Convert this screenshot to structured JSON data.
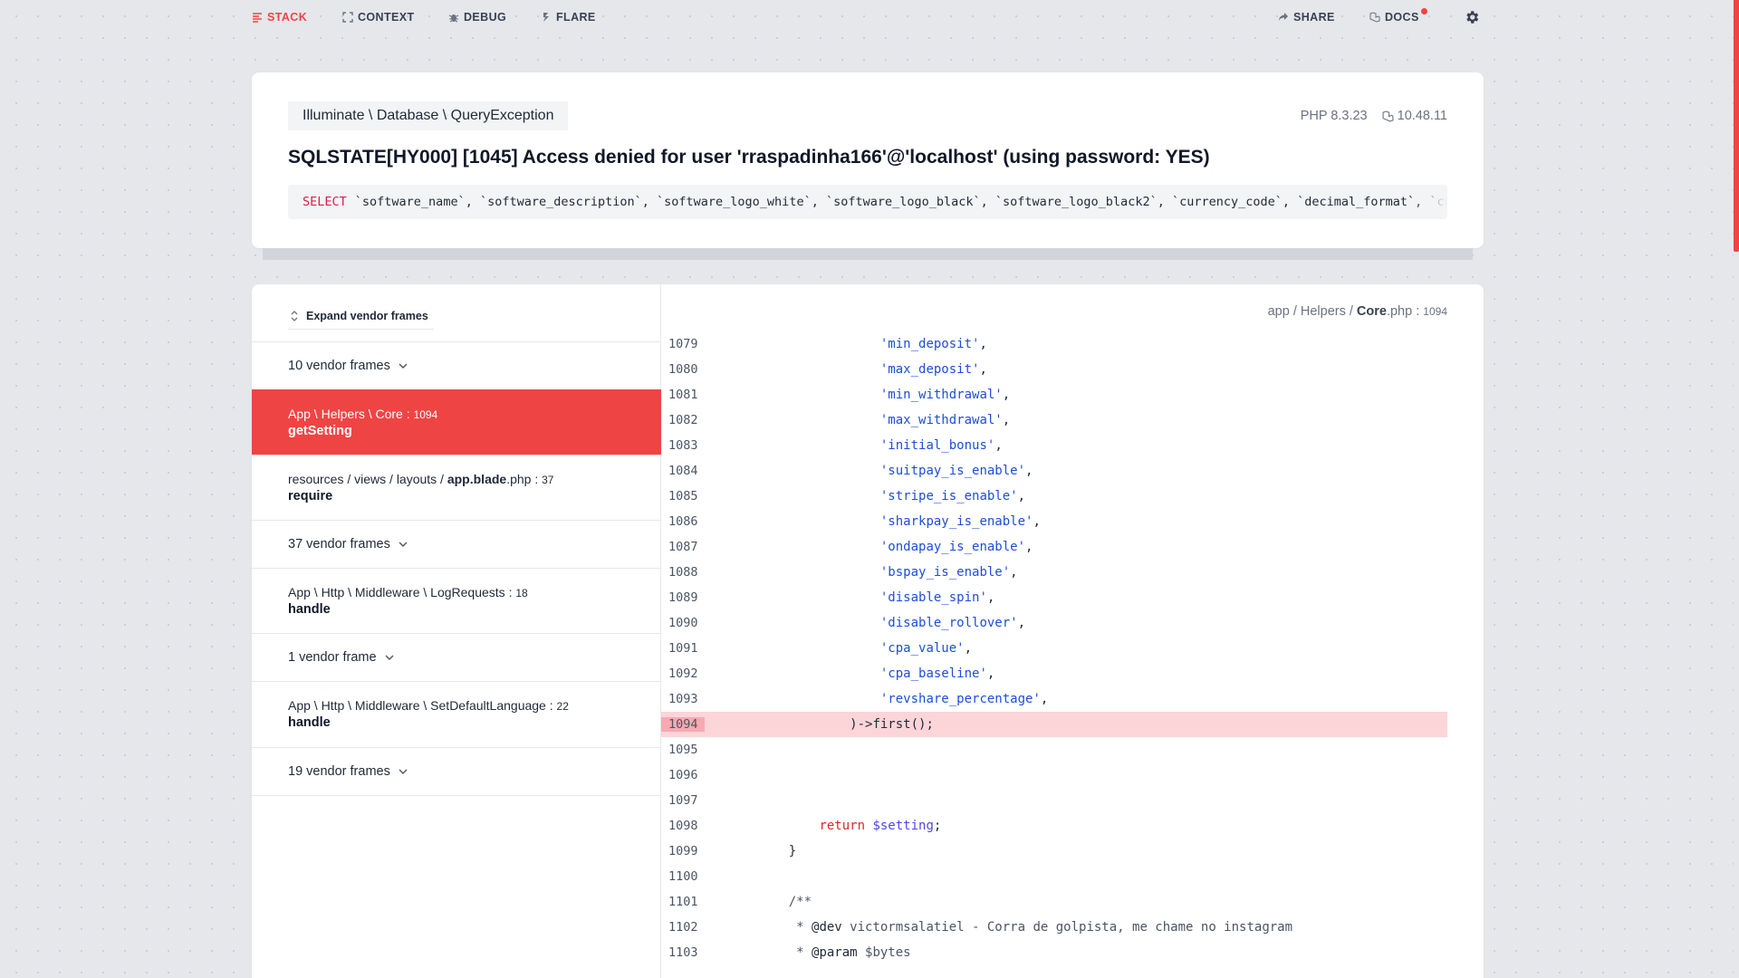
{
  "nav": {
    "stack": "STACK",
    "context": "CONTEXT",
    "debug": "DEBUG",
    "flare": "FLARE",
    "share": "SHARE",
    "docs": "DOCS"
  },
  "header": {
    "exception_class": "Illuminate \\ Database \\ QueryException",
    "php_version": "PHP 8.3.23",
    "laravel_version": "10.48.11",
    "message": "SQLSTATE[HY000] [1045] Access denied for user 'rraspadinha166'@'localhost' (using password: YES)",
    "sql_keyword": "SELECT",
    "sql_rest": "`software_name`, `software_description`, `software_logo_white`, `software_logo_black`, `software_logo_black2`, `currency_code`, `decimal_format`, `cu"
  },
  "frames": {
    "expand_label": "Expand vendor frames",
    "vendor1": "10 vendor frames",
    "f1_path": "App \\ Helpers \\ Core",
    "f1_line": "1094",
    "f1_fn": "getSetting",
    "f2_path_prefix": "resources / views / layouts / ",
    "f2_path_bold": "app.blade",
    "f2_path_ext": ".php",
    "f2_line": "37",
    "f2_fn": "require",
    "vendor2": "37 vendor frames",
    "f3_path": "App \\ Http \\ Middleware \\ LogRequests",
    "f3_line": "18",
    "f3_fn": "handle",
    "vendor3": "1 vendor frame",
    "f4_path": "App \\ Http \\ Middleware \\ SetDefaultLanguage",
    "f4_line": "22",
    "f4_fn": "handle",
    "vendor4": "19 vendor frames"
  },
  "code": {
    "file_dir": "app / Helpers / ",
    "file_name": "Core",
    "file_ext": ".php",
    "file_line": "1094",
    "highlight_line": 1094,
    "lines": [
      {
        "n": "1079",
        "indent": "                ",
        "str": "'min_deposit'",
        "tail": ","
      },
      {
        "n": "1080",
        "indent": "                ",
        "str": "'max_deposit'",
        "tail": ","
      },
      {
        "n": "1081",
        "indent": "                ",
        "str": "'min_withdrawal'",
        "tail": ","
      },
      {
        "n": "1082",
        "indent": "                ",
        "str": "'max_withdrawal'",
        "tail": ","
      },
      {
        "n": "1083",
        "indent": "                ",
        "str": "'initial_bonus'",
        "tail": ","
      },
      {
        "n": "1084",
        "indent": "                ",
        "str": "'suitpay_is_enable'",
        "tail": ","
      },
      {
        "n": "1085",
        "indent": "                ",
        "str": "'stripe_is_enable'",
        "tail": ","
      },
      {
        "n": "1086",
        "indent": "                ",
        "str": "'sharkpay_is_enable'",
        "tail": ","
      },
      {
        "n": "1087",
        "indent": "                ",
        "str": "'ondapay_is_enable'",
        "tail": ","
      },
      {
        "n": "1088",
        "indent": "                ",
        "str": "'bspay_is_enable'",
        "tail": ","
      },
      {
        "n": "1089",
        "indent": "                ",
        "str": "'disable_spin'",
        "tail": ","
      },
      {
        "n": "1090",
        "indent": "                ",
        "str": "'disable_rollover'",
        "tail": ","
      },
      {
        "n": "1091",
        "indent": "                ",
        "str": "'cpa_value'",
        "tail": ","
      },
      {
        "n": "1092",
        "indent": "                ",
        "str": "'cpa_baseline'",
        "tail": ","
      },
      {
        "n": "1093",
        "indent": "                ",
        "str": "'revshare_percentage'",
        "tail": ","
      },
      {
        "n": "1094",
        "indent": "            ",
        "plain": ")->first();"
      },
      {
        "n": "1095"
      },
      {
        "n": "1096"
      },
      {
        "n": "1097"
      },
      {
        "n": "1098",
        "indent": "        ",
        "kw": "return",
        "var": "$setting",
        "tail": ";"
      },
      {
        "n": "1099",
        "indent": "    ",
        "plain": "}"
      },
      {
        "n": "1100"
      },
      {
        "n": "1101",
        "indent": "    ",
        "cmt": "/**"
      },
      {
        "n": "1102",
        "indent": "     ",
        "cmt": "* ",
        "tag": "@dev",
        "cmt2": " victormsalatiel - Corra de golpista, me chame no instagram"
      },
      {
        "n": "1103",
        "indent": "     ",
        "cmt": "* ",
        "tag": "@param",
        "cmt2": " $bytes"
      }
    ]
  }
}
